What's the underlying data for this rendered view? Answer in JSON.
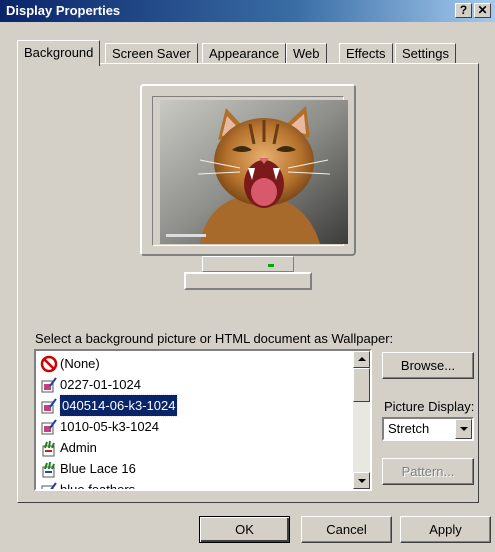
{
  "window": {
    "title": "Display Properties",
    "help_label": "?",
    "close_label": "✕"
  },
  "tabs": [
    {
      "label": "Background",
      "active": true
    },
    {
      "label": "Screen Saver"
    },
    {
      "label": "Appearance"
    },
    {
      "label": "Web"
    },
    {
      "label": "Effects"
    },
    {
      "label": "Settings"
    }
  ],
  "preview": {
    "caption": "cat-photo-preview"
  },
  "wallpaper": {
    "prompt": "Select a background picture or HTML document as Wallpaper:",
    "items": [
      {
        "label": "(None)",
        "icon": "none-icon"
      },
      {
        "label": "0227-01-1024",
        "icon": "image-file-icon"
      },
      {
        "label": "040514-06-k3-1024",
        "icon": "image-file-icon",
        "selected": true
      },
      {
        "label": "1010-05-k3-1024",
        "icon": "image-file-icon"
      },
      {
        "label": "Admin",
        "icon": "bitmap-file-icon"
      },
      {
        "label": "Blue Lace 16",
        "icon": "bitmap-file-icon"
      },
      {
        "label": "blue feathers",
        "icon": "image-file-icon"
      }
    ]
  },
  "buttons": {
    "browse": "Browse...",
    "pattern": "Pattern...",
    "ok": "OK",
    "cancel": "Cancel",
    "apply": "Apply"
  },
  "picture_display": {
    "label": "Picture Display:",
    "value": "Stretch"
  },
  "colors": {
    "title_start": "#0a246a",
    "title_end": "#a6caf0",
    "selection": "#0a246a",
    "face": "#d4d0c8"
  }
}
